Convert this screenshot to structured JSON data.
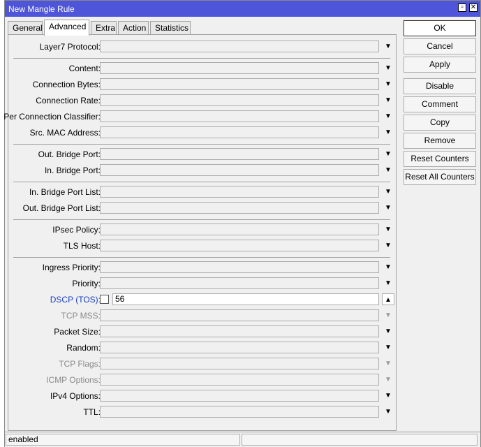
{
  "window": {
    "title": "New Mangle Rule"
  },
  "tabs": [
    "General",
    "Advanced",
    "Extra",
    "Action",
    "Statistics"
  ],
  "fields": {
    "layer7_protocol": {
      "label": "Layer7 Protocol:"
    },
    "content": {
      "label": "Content:"
    },
    "connection_bytes": {
      "label": "Connection Bytes:"
    },
    "connection_rate": {
      "label": "Connection Rate:"
    },
    "per_connection_classifier": {
      "label": "Per Connection Classifier:"
    },
    "src_mac_address": {
      "label": "Src. MAC Address:"
    },
    "out_bridge_port": {
      "label": "Out. Bridge Port:"
    },
    "in_bridge_port": {
      "label": "In. Bridge Port:"
    },
    "in_bridge_port_list": {
      "label": "In. Bridge Port List:"
    },
    "out_bridge_port_list": {
      "label": "Out. Bridge Port List:"
    },
    "ipsec_policy": {
      "label": "IPsec Policy:"
    },
    "tls_host": {
      "label": "TLS Host:"
    },
    "ingress_priority": {
      "label": "Ingress Priority:"
    },
    "priority": {
      "label": "Priority:"
    },
    "dscp_tos": {
      "label": "DSCP (TOS):",
      "value": "56"
    },
    "tcp_mss": {
      "label": "TCP MSS:"
    },
    "packet_size": {
      "label": "Packet Size:"
    },
    "random": {
      "label": "Random:"
    },
    "tcp_flags": {
      "label": "TCP Flags:"
    },
    "icmp_options": {
      "label": "ICMP Options:"
    },
    "ipv4_options": {
      "label": "IPv4 Options:"
    },
    "ttl": {
      "label": "TTL:"
    }
  },
  "buttons": {
    "ok": "OK",
    "cancel": "Cancel",
    "apply": "Apply",
    "disable": "Disable",
    "comment": "Comment",
    "copy": "Copy",
    "remove": "Remove",
    "reset_counters": "Reset Counters",
    "reset_all_counters": "Reset All Counters"
  },
  "status": {
    "state": "enabled"
  },
  "colors": {
    "titlebar": "#4f55d9",
    "label_active": "#1c3fbf",
    "label_disabled": "#8a8a8a"
  },
  "icons": {
    "dropdown": "triangle-down",
    "spinner_up": "triangle-up",
    "minimize": "square",
    "close": "x"
  }
}
